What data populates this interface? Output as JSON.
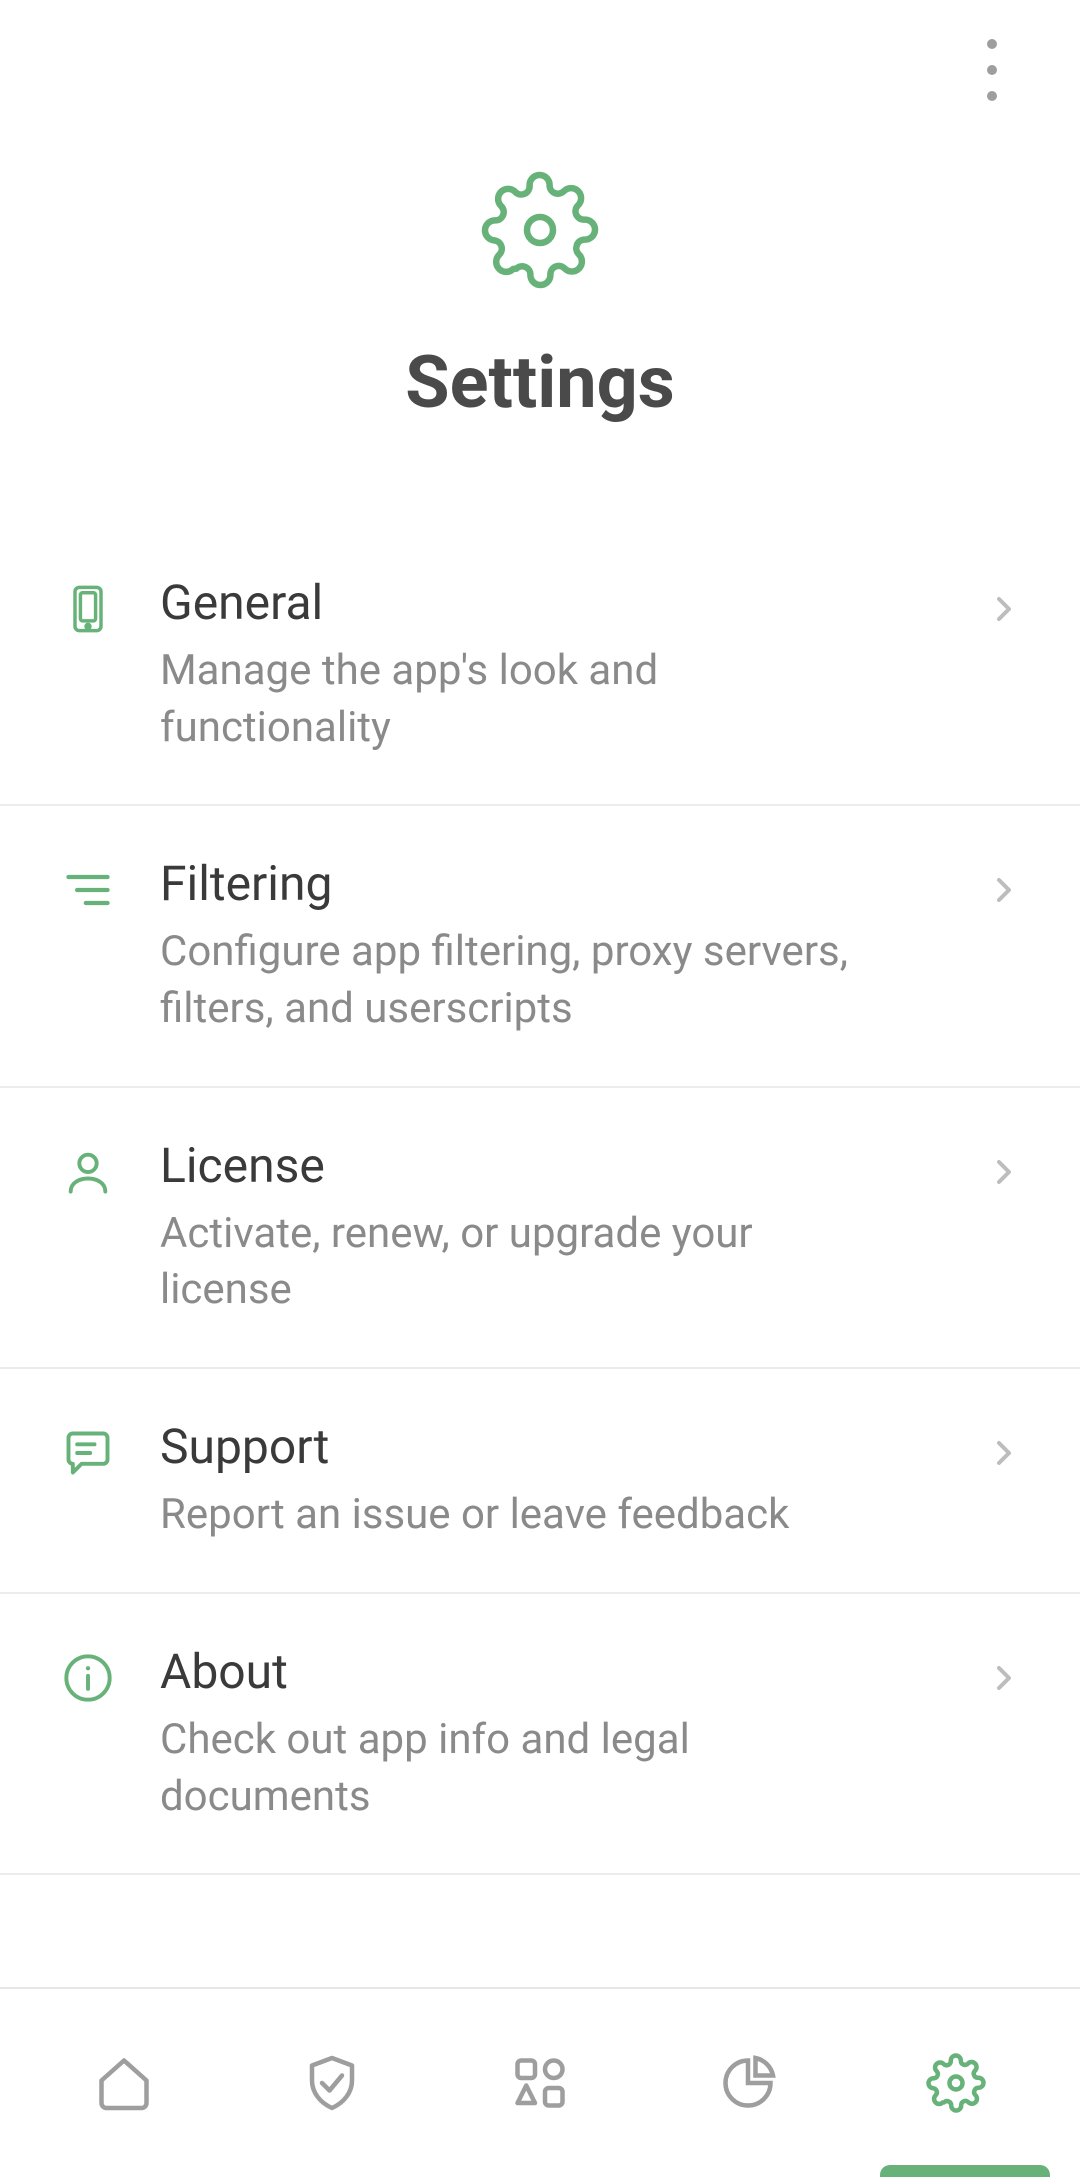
{
  "colors": {
    "accent": "#67b279",
    "text_primary": "#3a3a3a",
    "text_secondary": "#8a8a8a",
    "icon_muted": "#9e9e9e"
  },
  "header": {
    "title": "Settings"
  },
  "items": [
    {
      "icon": "device-icon",
      "title": "General",
      "subtitle": "Manage the app's look and functionality"
    },
    {
      "icon": "filter-icon",
      "title": "Filtering",
      "subtitle": "Configure app filtering, proxy servers, filters, and userscripts"
    },
    {
      "icon": "user-icon",
      "title": "License",
      "subtitle": "Activate, renew, or upgrade your license"
    },
    {
      "icon": "chat-icon",
      "title": "Support",
      "subtitle": "Report an issue or leave feedback"
    },
    {
      "icon": "info-icon",
      "title": "About",
      "subtitle": "Check out app info and legal documents"
    }
  ],
  "nav": {
    "active_index": 4,
    "items": [
      "home",
      "protection",
      "apps",
      "stats",
      "settings"
    ]
  }
}
